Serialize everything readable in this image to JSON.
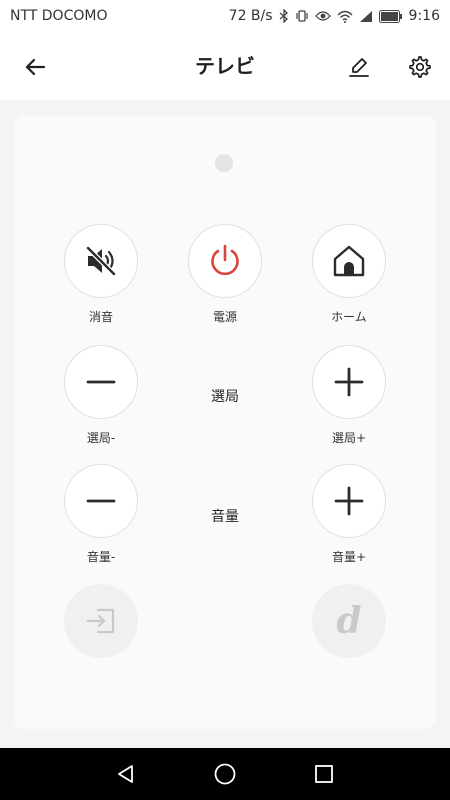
{
  "status_bar": {
    "carrier": "NTT DOCOMO",
    "speed": "72 B/s",
    "time": "9:16",
    "icons": [
      "bluetooth-icon",
      "vibrate-icon",
      "eye-icon",
      "wifi-icon",
      "signal-icon",
      "battery-icon"
    ]
  },
  "header": {
    "title": "テレビ",
    "icons": [
      "back-arrow-icon",
      "edit-pen-icon",
      "gear-icon"
    ]
  },
  "remote": {
    "mute_label": "消音",
    "power_label": "電源",
    "home_label": "ホーム",
    "channel_down_label": "選局-",
    "channel_label": "選局",
    "channel_up_label": "選局+",
    "volume_down_label": "音量-",
    "volume_label": "音量",
    "volume_up_label": "音量+",
    "input_icon": "input-switch-icon",
    "d_button_text": "d"
  },
  "colors": {
    "power": "#d9443c",
    "icon_dark": "#2b2b2b",
    "disabled": "#c9c9c9"
  },
  "nav_bar": {
    "icons": [
      "back-triangle-icon",
      "home-circle-icon",
      "recents-square-icon"
    ]
  }
}
